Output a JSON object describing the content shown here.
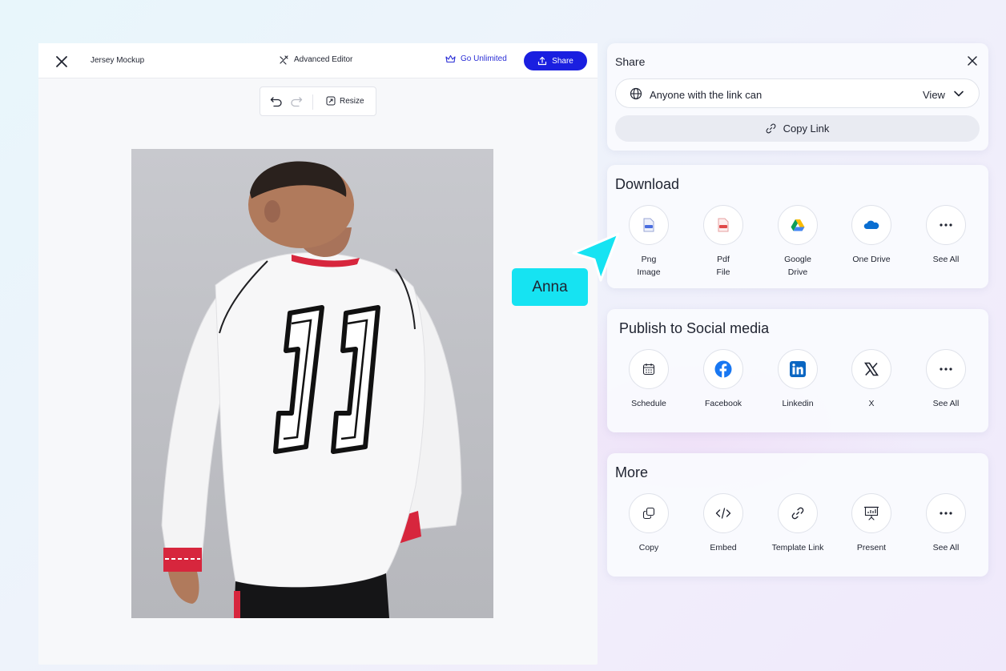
{
  "editor": {
    "doc_title": "Jersey Mockup",
    "advanced_editor_label": "Advanced Editor",
    "go_unlimited_label": "Go Unlimited",
    "share_button_label": "Share",
    "toolbar": {
      "resize_label": "Resize"
    },
    "canvas": {
      "jersey_number": "11"
    }
  },
  "share_panel": {
    "title": "Share",
    "link_access": {
      "text": "Anyone with the link can",
      "permission": "View"
    },
    "copy_link_label": "Copy Link"
  },
  "download": {
    "title": "Download",
    "items": [
      {
        "label": "Png\nImage",
        "icon": "png-file-icon"
      },
      {
        "label": "Pdf\nFile",
        "icon": "pdf-file-icon"
      },
      {
        "label": "Google\nDrive",
        "icon": "google-drive-icon"
      },
      {
        "label": "One Drive",
        "icon": "onedrive-icon"
      },
      {
        "label": "See All",
        "icon": "more-dots-icon"
      }
    ]
  },
  "publish": {
    "title": "Publish to Social media",
    "items": [
      {
        "label": "Schedule",
        "icon": "calendar-icon"
      },
      {
        "label": "Facebook",
        "icon": "facebook-icon"
      },
      {
        "label": "Linkedin",
        "icon": "linkedin-icon"
      },
      {
        "label": "X",
        "icon": "x-logo-icon"
      },
      {
        "label": "See All",
        "icon": "more-dots-icon"
      }
    ]
  },
  "more": {
    "title": "More",
    "items": [
      {
        "label": "Copy",
        "icon": "copy-icon"
      },
      {
        "label": "Embed",
        "icon": "code-icon"
      },
      {
        "label": "Template Link",
        "icon": "link-icon"
      },
      {
        "label": "Present",
        "icon": "presentation-icon"
      },
      {
        "label": "See All",
        "icon": "more-dots-icon"
      }
    ]
  },
  "collaborator": {
    "name": "Anna",
    "color": "#16e3f2"
  },
  "colors": {
    "primary": "#1a1fe0",
    "accent_text": "#2b2fd6",
    "facebook": "#1877f2",
    "linkedin": "#0a66c2"
  }
}
